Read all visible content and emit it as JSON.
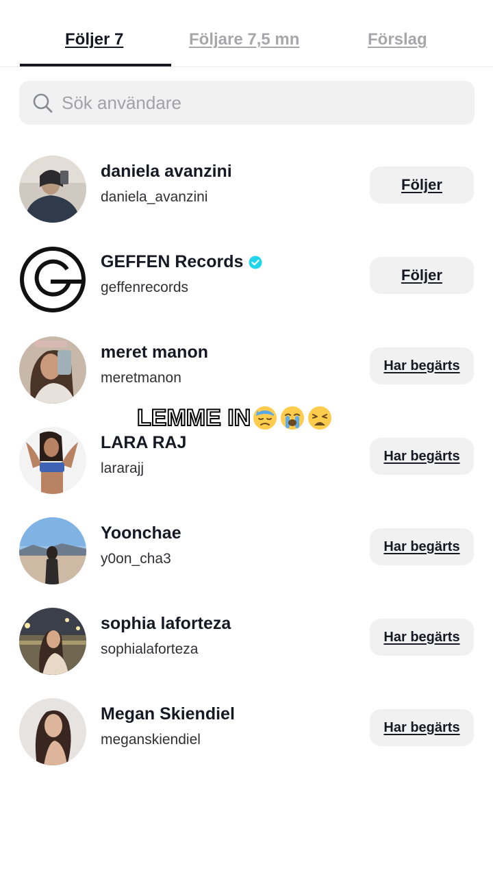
{
  "tabs": [
    {
      "label": "Följer 7",
      "active": true
    },
    {
      "label": "Följare 7,5 mn",
      "active": false
    },
    {
      "label": "Förslag",
      "active": false
    }
  ],
  "search": {
    "placeholder": "Sök användare",
    "value": ""
  },
  "users": [
    {
      "name": "daniela avanzini",
      "handle": "daniela_avanzini",
      "button": "Följer",
      "verified": false
    },
    {
      "name": "GEFFEN Records",
      "handle": "geffenrecords",
      "button": "Följer",
      "verified": true
    },
    {
      "name": "meret manon",
      "handle": "meretmanon",
      "button": "Har begärts",
      "verified": false
    },
    {
      "name": "LARA RAJ",
      "handle": "lararajj",
      "button": "Har begärts",
      "verified": false
    },
    {
      "name": "Yoonchae",
      "handle": "y0on_cha3",
      "button": "Har begärts",
      "verified": false
    },
    {
      "name": "sophia laforteza",
      "handle": "sophialaforteza",
      "button": "Har begärts",
      "verified": false
    },
    {
      "name": "Megan Skiendiel",
      "handle": "meganskiendiel",
      "button": "Har begärts",
      "verified": false
    }
  ],
  "overlay": {
    "caption": "LEMME IN",
    "emojis": [
      "downcast-sweat-emoji",
      "loudly-crying-emoji",
      "weary-emoji"
    ]
  },
  "colors": {
    "accent": "#20d5ec",
    "text": "#161823",
    "muted": "#a7a7ab",
    "button_bg": "#f1f1f2"
  }
}
